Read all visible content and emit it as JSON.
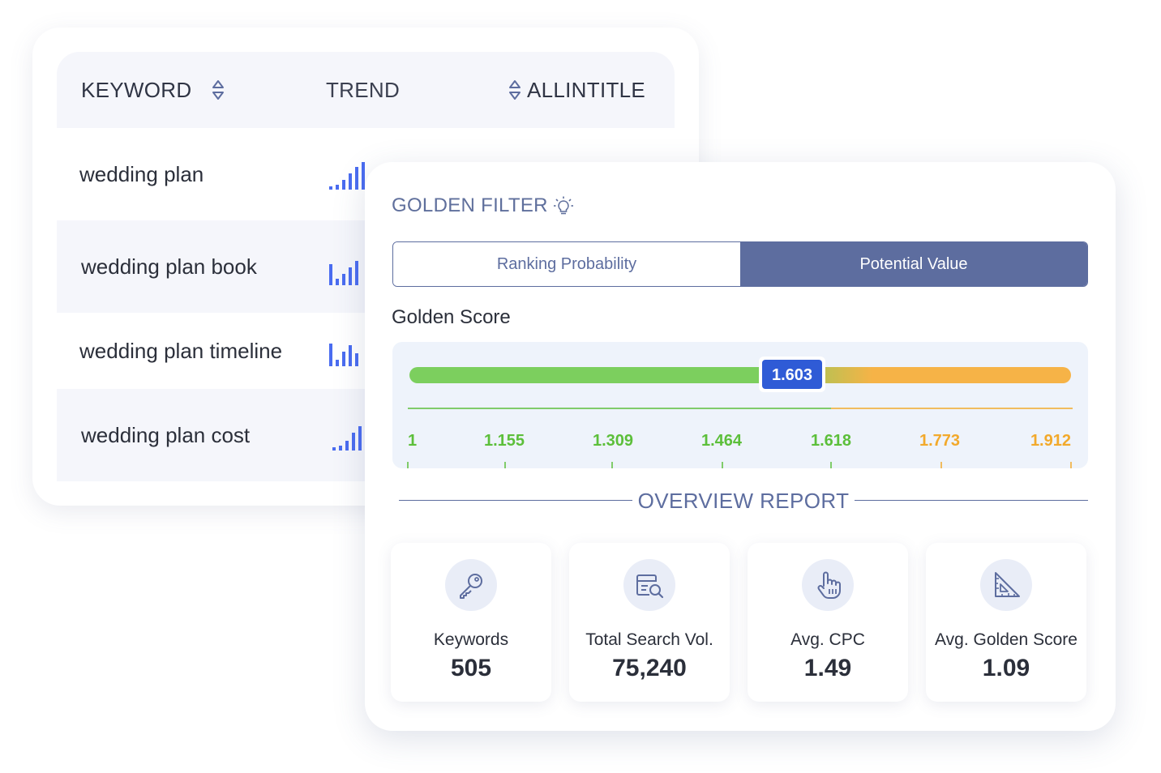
{
  "keyword_table": {
    "columns": {
      "keyword": "KEYWORD",
      "trend": "TREND",
      "allintitle": "ALLINTITLE"
    },
    "rows": [
      {
        "keyword": "wedding plan"
      },
      {
        "keyword": "wedding plan book"
      },
      {
        "keyword": "wedding plan timeline"
      },
      {
        "keyword": "wedding plan cost"
      }
    ]
  },
  "golden_filter": {
    "title": "GOLDEN FILTER",
    "tabs": [
      {
        "label": "Ranking Probability",
        "active": false
      },
      {
        "label": "Potential Value",
        "active": true
      }
    ],
    "score_label": "Golden Score",
    "score": {
      "current": "1.603",
      "ticks": [
        "1",
        "1.155",
        "1.309",
        "1.464",
        "1.618",
        "1.773",
        "1.912"
      ],
      "colors": {
        "low": "#7ccf5e",
        "high": "#f6b347",
        "marker": "#2f5bd6"
      }
    },
    "overview_title": "OVERVIEW REPORT",
    "stats": [
      {
        "label": "Keywords",
        "value": "505",
        "icon": "key-icon"
      },
      {
        "label": "Total Search Vol.",
        "value": "75,240",
        "icon": "search-volume-icon"
      },
      {
        "label": "Avg. CPC",
        "value": "1.49",
        "icon": "hand-pointer-icon"
      },
      {
        "label": "Avg. Golden Score",
        "value": "1.09",
        "icon": "ruler-triangle-icon"
      }
    ]
  },
  "colors": {
    "accent": "#5d6d9f",
    "trend_bar": "#4a6cf0",
    "panel_bg": "#eef3fb"
  }
}
